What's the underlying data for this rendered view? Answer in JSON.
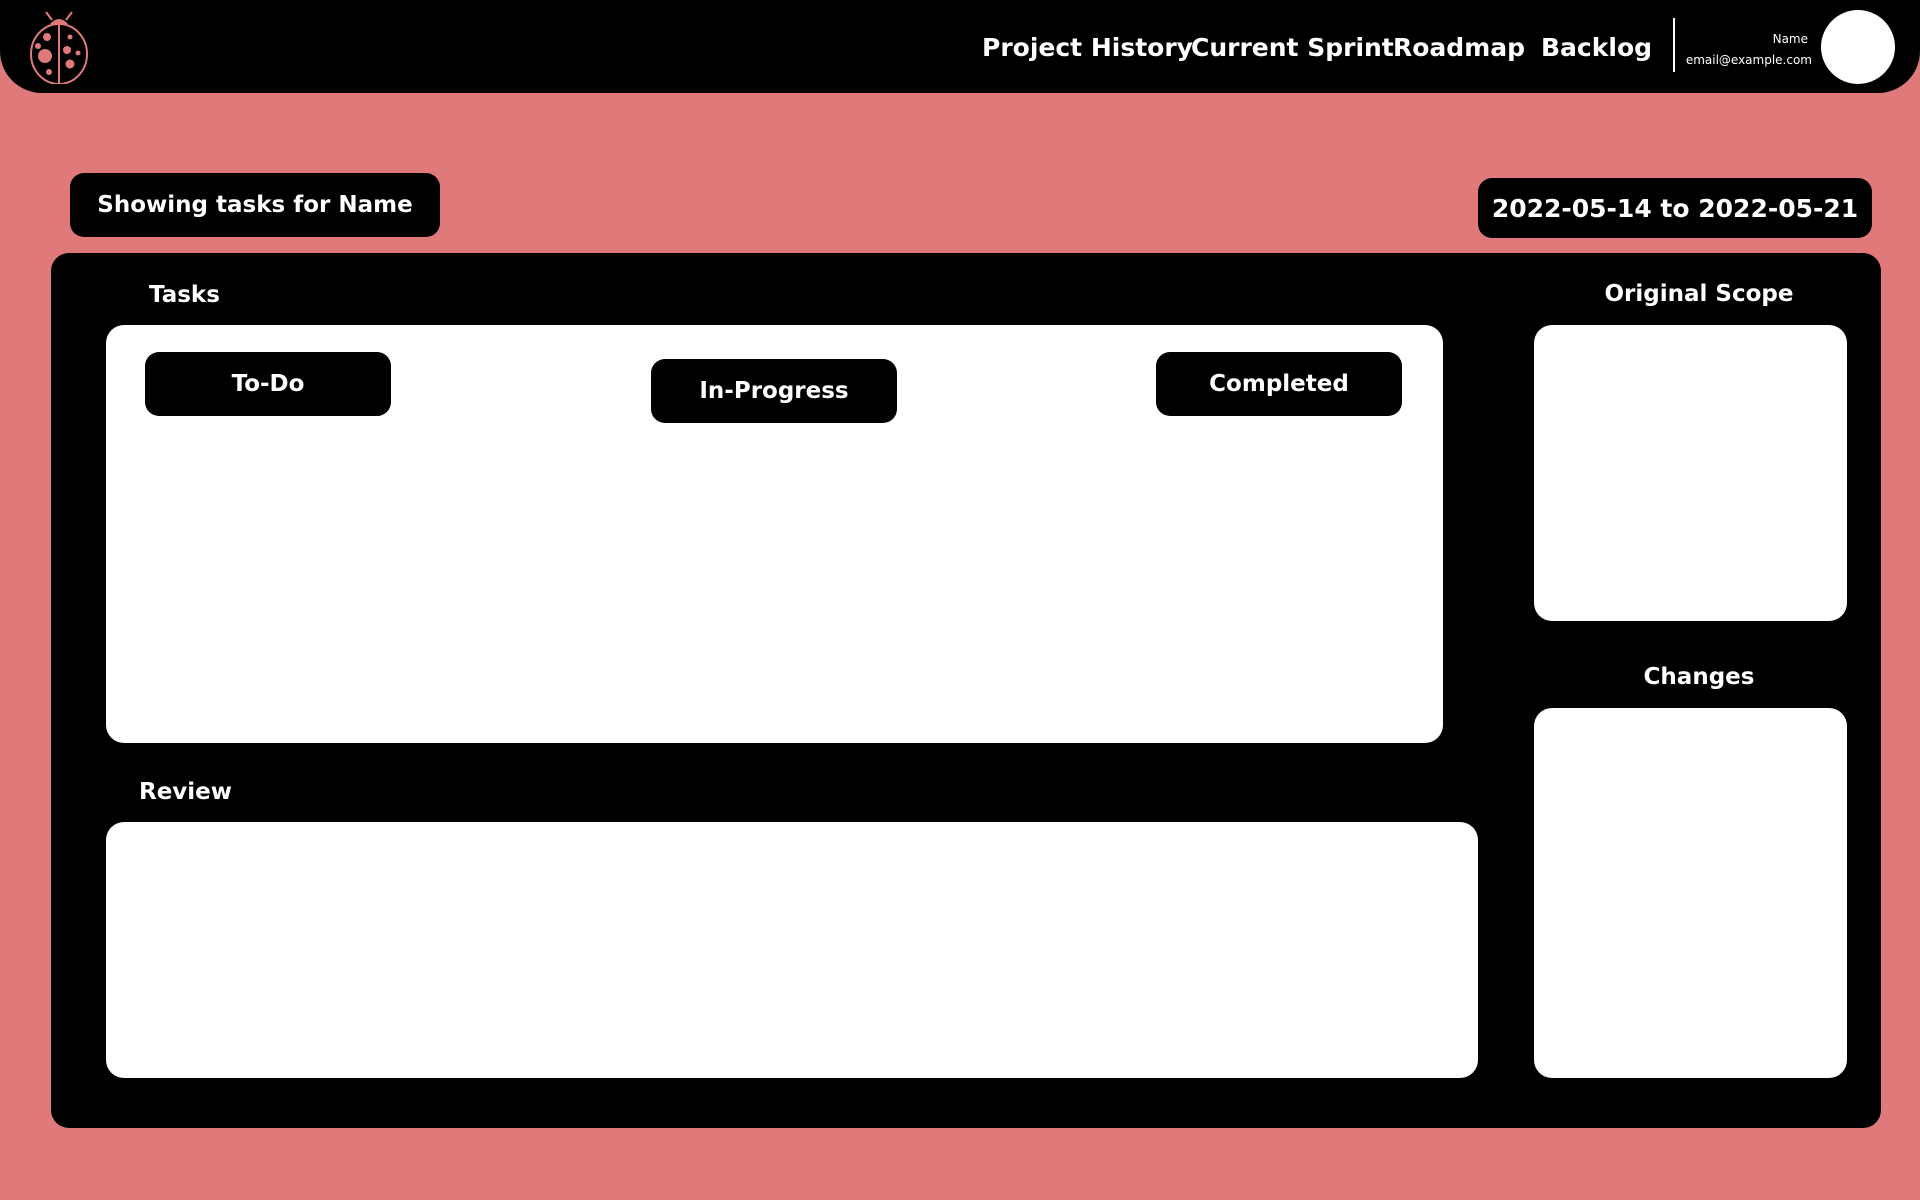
{
  "nav": {
    "links": [
      "Project History",
      "Current Sprint",
      "Roadmap",
      "Backlog"
    ],
    "user_name": "Name",
    "user_email": "email@example.com"
  },
  "filter": {
    "showing": "Showing tasks for Name",
    "date_range": "2022-05-14 to 2022-05-21"
  },
  "board": {
    "tasks_title": "Tasks",
    "columns": [
      "To-Do",
      "In-Progress",
      "Completed"
    ],
    "review_title": "Review",
    "original_scope_title": "Original Scope",
    "changes_title": "Changes"
  },
  "colors": {
    "background": "#e07a7a",
    "panel_dark": "#000000",
    "panel_light": "#ffffff"
  },
  "icons": {
    "logo": "ladybug-icon",
    "avatar": "user-avatar"
  }
}
